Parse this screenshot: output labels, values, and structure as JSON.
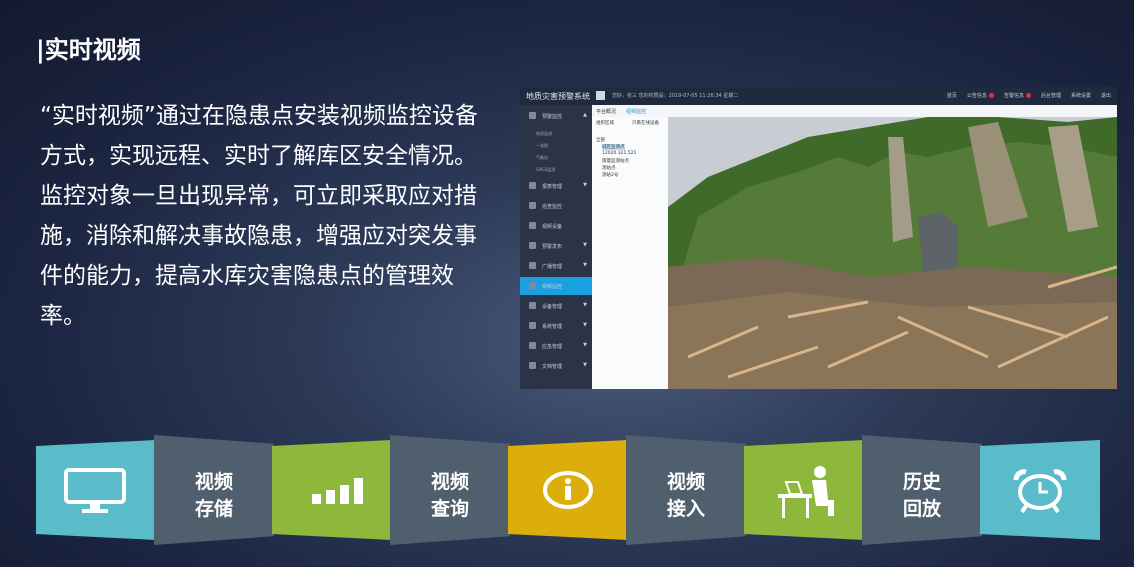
{
  "header": {
    "title": "|实时视频"
  },
  "body_text": "“实时视频”通过在隐患点安装视频监控设备方式，实现远程、实时了解库区安全情况。监控对象一旦出现异常，可立即采取应对措施，消除和解决事故隐患，增强应对突发事件的能力，提高水库灾害隐患点的管理效率。",
  "screenshot": {
    "brand": "地质灾害预警系统",
    "info": "您好，张三 您的权限是：2019-07-05 11:26:34 星期二",
    "top_links": [
      "首页",
      "公告信息",
      "告警信息",
      "后台管理",
      "系统设置",
      "退出"
    ],
    "sidebar": [
      "预警监控",
      "地质监测",
      "一张图",
      "气象站",
      "GNSS监测",
      "报表管理",
      "巡查监控",
      "视频设备",
      "预警发布",
      "广播管理",
      "视频监控",
      "设备管理",
      "系统管理",
      "应急管理",
      "文档管理"
    ],
    "tabs": [
      "平台概况",
      "视频监控"
    ],
    "tree_header": [
      "组织区域",
      "只看在线设备"
    ],
    "tree_items": [
      "全部",
      "城区监测点",
      "12020.321.521",
      "雨量监测站点",
      "测站点",
      "测站2号"
    ]
  },
  "features": [
    {
      "icon": "monitor-icon",
      "line1": "视频",
      "line2": "存储"
    },
    {
      "icon": "bar-chart-icon",
      "line1": "视频",
      "line2": "查询"
    },
    {
      "icon": "info-icon",
      "line1": "视频",
      "line2": "接入"
    },
    {
      "icon": "person-at-desk-icon",
      "line1": "历史",
      "line2": "回放"
    },
    {
      "icon": "alarm-clock-icon"
    }
  ],
  "colors": {
    "teal": "#5bbcc9",
    "slate": "#4f5f6e",
    "green": "#8eb83c",
    "yellow": "#dcae0b"
  }
}
